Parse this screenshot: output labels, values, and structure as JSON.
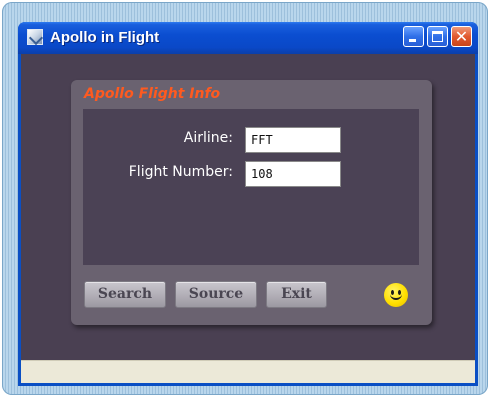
{
  "window": {
    "title": "Apollo in Flight",
    "icon": "app-icon",
    "controls": [
      "minimize-icon",
      "maximize-icon",
      "close-icon"
    ]
  },
  "panel": {
    "title": "Apollo Flight Info",
    "fields": [
      {
        "label": "Airline:",
        "value": "FFT"
      },
      {
        "label": "Flight Number:",
        "value": "108"
      }
    ],
    "buttons": {
      "search": "Search",
      "source": "Source",
      "exit": "Exit"
    },
    "indicator_icon": "smiley-icon"
  },
  "colors": {
    "title_accent": "#ff5a1f",
    "window_background": "#4a4052",
    "panel_background": "#6a6270",
    "titlebar": "#0b4ed1"
  }
}
